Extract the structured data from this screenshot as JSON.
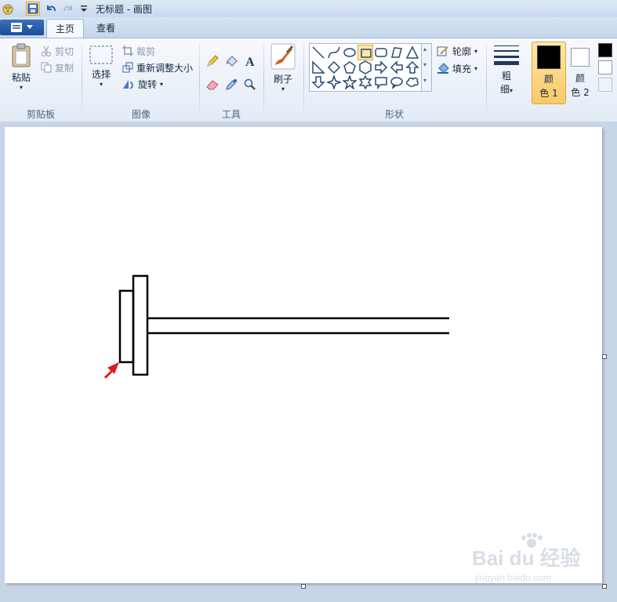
{
  "window": {
    "title": "无标题 - 画图"
  },
  "tabs": [
    {
      "label": "主页",
      "active": true
    },
    {
      "label": "查看",
      "active": false
    }
  ],
  "clipboard": {
    "paste_label": "粘贴",
    "cut_label": "剪切",
    "copy_label": "复制",
    "group_label": "剪贴板"
  },
  "image": {
    "select_label": "选择",
    "crop_label": "裁剪",
    "resize_label": "重新调整大小",
    "rotate_label": "旋转",
    "group_label": "图像"
  },
  "tools": {
    "group_label": "工具",
    "items": [
      "pencil-icon",
      "fill-icon",
      "text-icon",
      "eraser-icon",
      "color-picker-icon",
      "magnifier-icon"
    ]
  },
  "brushes": {
    "label": "刷子"
  },
  "shapes": {
    "group_label": "形状",
    "outline_label": "轮廓",
    "fill_label": "填充",
    "selected": "rectangle"
  },
  "size": {
    "label_line1": "粗",
    "label_line2": "细"
  },
  "colors": {
    "color1_line1": "颜",
    "color1_line2": "色 1",
    "color1_value": "#000000",
    "color2_line1": "颜",
    "color2_line2": "色 2",
    "color2_value": "#ffffff",
    "palette": [
      "#000000",
      "#ffffff"
    ]
  },
  "watermark": {
    "main": "Bai du 经验",
    "sub": "jingyan.baidu.com"
  }
}
